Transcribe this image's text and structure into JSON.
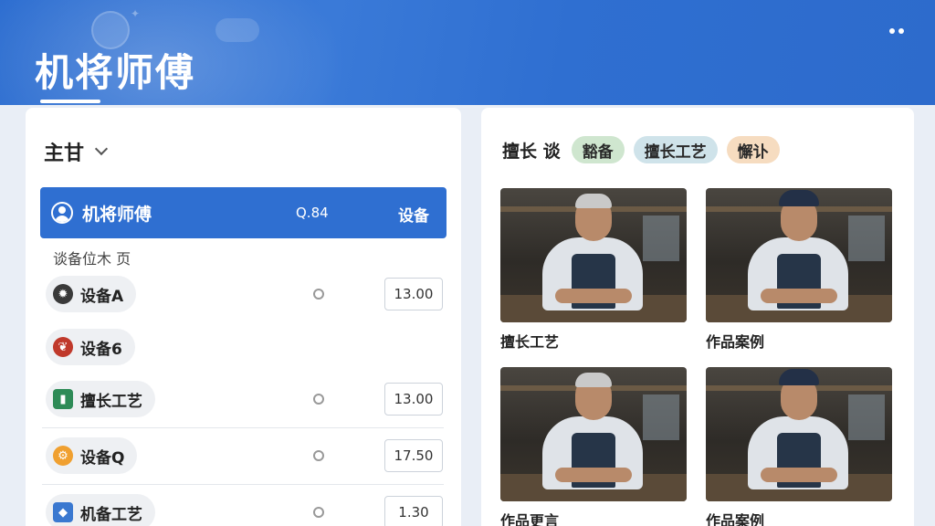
{
  "header": {
    "title": "机将师傅"
  },
  "left": {
    "section_title": "主甘",
    "selected": {
      "name": "机将师傅",
      "meta": "Q.84",
      "tag": "设备"
    },
    "sub_label": "谈备位木 页",
    "items": [
      {
        "label": "设备A",
        "value": "13.00",
        "icon": "gear-star-icon",
        "icon_color": "#3a3a3a"
      },
      {
        "label": "设备6",
        "value": "",
        "icon": "plant-icon",
        "icon_color": "#c0392b"
      },
      {
        "label": "擅长工艺",
        "value": "13.00",
        "icon": "cylinder-icon",
        "icon_color": "#2e8b57"
      },
      {
        "label": "设备Q",
        "value": "17.50",
        "icon": "machine-icon",
        "icon_color": "#f0a030"
      },
      {
        "label": "机备工艺",
        "value": "1.30",
        "icon": "tag-icon",
        "icon_color": "#3a78d0"
      }
    ]
  },
  "right": {
    "spec_label": "擅长 谈",
    "tags": [
      {
        "text": "豁备",
        "color": "green"
      },
      {
        "text": "擅长工艺",
        "color": "blue"
      },
      {
        "text": "懈讣",
        "color": "orange"
      }
    ],
    "cards": [
      {
        "label": "擅长工艺",
        "headwear": "hair"
      },
      {
        "label": "作品案例",
        "headwear": "cap"
      },
      {
        "label": "作品更言",
        "headwear": "hair"
      },
      {
        "label": "作品案例",
        "headwear": "cap"
      }
    ]
  }
}
